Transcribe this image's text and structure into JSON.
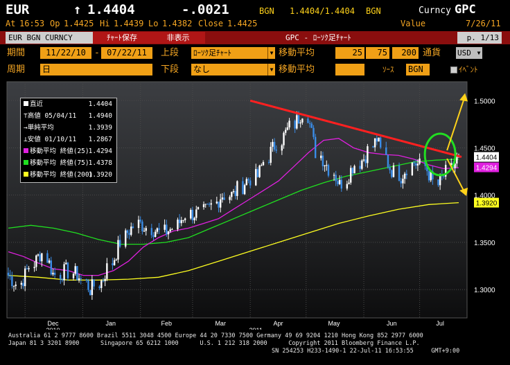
{
  "header": {
    "ticker": "EUR",
    "arrow": "↑",
    "last": "1.4404",
    "change": "-.0021",
    "source": "BGN",
    "bid_ask": "1.4404/1.4404",
    "source2": "BGN",
    "ticker_type": "Curncy",
    "function": "GPC",
    "row2_at": "At",
    "time": "16:53",
    "op_label": "Op",
    "op": "1.4425",
    "hi_label": "Hi",
    "hi": "1.4439",
    "lo_label": "Lo",
    "lo": "1.4382",
    "close_label": "Close",
    "close": "1.4425",
    "value_label": "Value",
    "value_date": "7/26/11"
  },
  "tabs": [
    {
      "label": "EUR BGN CURNCY",
      "selected": true
    },
    {
      "label": "ﾁｬｰﾄ保存",
      "selected": false
    },
    {
      "label": "非表示",
      "selected": false
    }
  ],
  "title_bar": {
    "label": "GPC - ﾛｰｿｸ足ﾁｬｰﾄ",
    "page": "p. 1/13"
  },
  "controls": {
    "period_label": "期間",
    "date_from": "11/22/10",
    "date_sep": "-",
    "date_to": "07/22/11",
    "upper_label": "上段",
    "upper_value": "ﾛｰｿｸ足ﾁｬｰﾄ",
    "ma_label": "移動平均",
    "ma1": "25",
    "ma2": "75",
    "ma3": "200",
    "currency_label": "通貨",
    "currency": "USD",
    "cycle_label": "周期",
    "cycle_value": "日",
    "lower_label": "下段",
    "lower_value": "なし",
    "ma_label2": "移動平均",
    "source_label": "ｿｰｽ",
    "source_value": "BGN",
    "event_label": "ｲﾍﾞﾝﾄ"
  },
  "legend": {
    "items": [
      {
        "label": "直近",
        "value": "1.4404",
        "icon": "square",
        "color": "#ffffff"
      },
      {
        "label": "高値 05/04/11",
        "value": "1.4940",
        "icon": "high-marker",
        "color": "#ffffff"
      },
      {
        "label": "単純平均",
        "value": "1.3939",
        "icon": "avg-marker",
        "color": "#ffffff"
      },
      {
        "label": "安値 01/10/11",
        "value": "1.2867",
        "icon": "low-marker",
        "color": "#ffffff"
      },
      {
        "label": "移動平均 終値(25)",
        "value": "1.4294",
        "icon": "square",
        "color": "#e020e0"
      },
      {
        "label": "移動平均 終値(75)",
        "value": "1.4378",
        "icon": "square",
        "color": "#20e020"
      },
      {
        "label": "移動平均 終値(200)",
        "value": "1.3920",
        "icon": "square",
        "color": "#ffff20"
      }
    ]
  },
  "chart_data": {
    "type": "candlestick",
    "title": "",
    "xlabel": "",
    "ylabel": "",
    "ylim": [
      1.27,
      1.52
    ],
    "y_ticks": [
      "1.5000",
      "1.4500",
      "1.4000",
      "1.3500",
      "1.3000"
    ],
    "x_ticks": [
      "Dec",
      "Jan",
      "Feb",
      "Mar",
      "Apr",
      "May",
      "Jun",
      "Jul"
    ],
    "x_year_labels": [
      "2010",
      "2011"
    ],
    "date_range": [
      "2010-11-22",
      "2011-07-22"
    ],
    "last_price": 1.4404,
    "high": {
      "date": "2011-05-04",
      "value": 1.494
    },
    "low": {
      "date": "2011-01-10",
      "value": 1.2867
    },
    "simple_average": 1.3939,
    "price_tags": [
      {
        "label": "1.4404",
        "value": 1.4404,
        "color": "#ffffff"
      },
      {
        "label": "1.4294",
        "value": 1.4294,
        "color": "#e020e0"
      },
      {
        "label": "1.3920",
        "value": 1.392,
        "color": "#ffff20"
      }
    ],
    "close_series_weekly": [
      1.315,
      1.305,
      1.325,
      1.34,
      1.315,
      1.32,
      1.315,
      1.3,
      1.31,
      1.335,
      1.36,
      1.37,
      1.365,
      1.36,
      1.365,
      1.38,
      1.38,
      1.385,
      1.4,
      1.4,
      1.415,
      1.42,
      1.445,
      1.46,
      1.475,
      1.49,
      1.445,
      1.43,
      1.41,
      1.43,
      1.44,
      1.46,
      1.43,
      1.42,
      1.435,
      1.43,
      1.41,
      1.425,
      1.44
    ],
    "moving_averages": [
      {
        "name": "移動平均 終値(25)",
        "color": "#e020e0",
        "values": [
          1.34,
          1.335,
          1.328,
          1.322,
          1.32,
          1.315,
          1.315,
          1.32,
          1.33,
          1.345,
          1.355,
          1.362,
          1.365,
          1.37,
          1.375,
          1.385,
          1.395,
          1.405,
          1.415,
          1.43,
          1.445,
          1.458,
          1.46,
          1.45,
          1.445,
          1.443,
          1.442,
          1.438,
          1.432,
          1.428,
          1.429
        ]
      },
      {
        "name": "移動平均 終値(75)",
        "color": "#20e020",
        "values": [
          1.365,
          1.368,
          1.365,
          1.36,
          1.353,
          1.348,
          1.348,
          1.35,
          1.355,
          1.365,
          1.375,
          1.385,
          1.395,
          1.405,
          1.413,
          1.42,
          1.425,
          1.43,
          1.435,
          1.437,
          1.438
        ]
      },
      {
        "name": "移動平均 終値(200)",
        "color": "#ffff20",
        "values": [
          1.315,
          1.313,
          1.31,
          1.31,
          1.311,
          1.313,
          1.32,
          1.33,
          1.34,
          1.35,
          1.36,
          1.37,
          1.378,
          1.385,
          1.39,
          1.392
        ]
      }
    ],
    "trendline": {
      "color": "#ff2020",
      "from": {
        "date": "2011-04-01",
        "value": 1.5
      },
      "to": {
        "date": "2011-07-22",
        "value": 1.4404
      }
    }
  },
  "footer": {
    "line1": "Australia 61 2 9777 8600 Brazil 5511 3048 4500 Europe 44 20 7330 7500 Germany 49 69 9204 1210 Hong Kong 852 2977 6000",
    "line2": "Japan 81 3 3201 8900      Singapore 65 6212 1000      U.S. 1 212 318 2000      Copyright 2011 Bloomberg Finance L.P.",
    "line3": "SN 254253 H233-1490-1 22-Jul-11 16:53:55     GMT+9:00"
  }
}
